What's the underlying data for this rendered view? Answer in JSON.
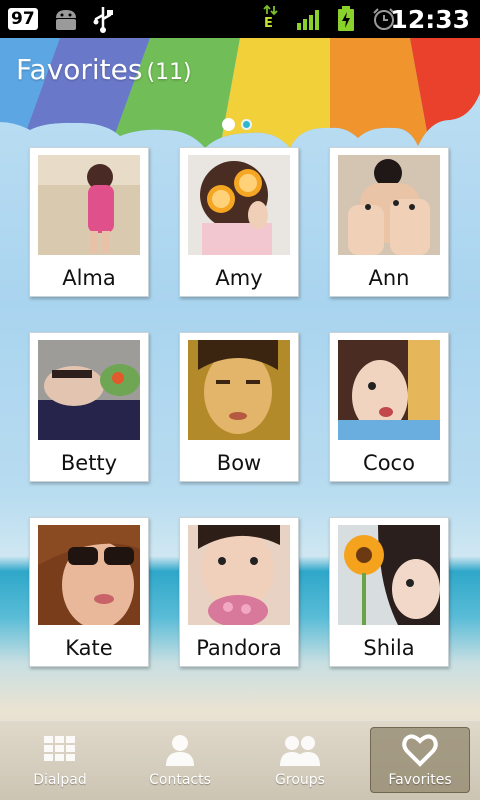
{
  "status_bar": {
    "battery_level": "97",
    "network_type": "E",
    "time": "12:33"
  },
  "header": {
    "title": "Favorites",
    "count": "(11)"
  },
  "pager": {
    "pages": 2,
    "active": 1
  },
  "favorites": [
    {
      "name": "Alma"
    },
    {
      "name": "Amy"
    },
    {
      "name": "Ann"
    },
    {
      "name": "Betty"
    },
    {
      "name": "Bow"
    },
    {
      "name": "Coco"
    },
    {
      "name": "Kate"
    },
    {
      "name": "Pandora"
    },
    {
      "name": "Shila"
    }
  ],
  "tabs": [
    {
      "label": "Dialpad",
      "icon": "dialpad-icon"
    },
    {
      "label": "Contacts",
      "icon": "contact-icon"
    },
    {
      "label": "Groups",
      "icon": "groups-icon"
    },
    {
      "label": "Favorites",
      "icon": "heart-icon",
      "selected": true
    }
  ],
  "colors": {
    "status_bar_bg": "#000000",
    "title_text": "#ffffff",
    "pager_active": "#ffffff",
    "pager_inactive": "#2fb6cf"
  }
}
